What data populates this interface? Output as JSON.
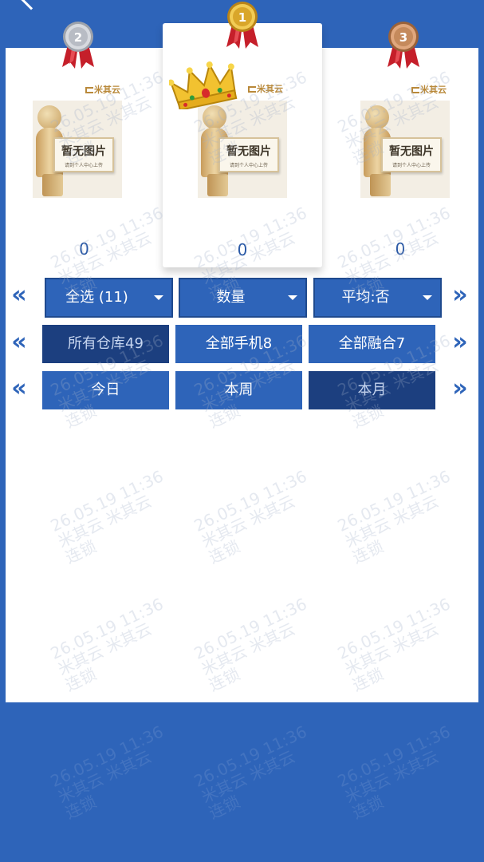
{
  "nav": {
    "back_icon": "chevron-left-icon"
  },
  "podium": {
    "first": {
      "rank": "1",
      "medal_color": "#d9a62a",
      "brand": "米其云",
      "sign_title": "暂无图片",
      "sign_sub": "请到个人中心上传",
      "score": "0"
    },
    "second": {
      "rank": "2",
      "medal_color": "#b8bcc4",
      "brand": "米其云",
      "sign_title": "暂无图片",
      "sign_sub": "请到个人中心上传",
      "score": "0"
    },
    "third": {
      "rank": "3",
      "medal_color": "#c58a5c",
      "brand": "米其云",
      "sign_title": "暂无图片",
      "sign_sub": "请到个人中心上传",
      "score": "0"
    }
  },
  "filters": {
    "row1": {
      "select_all": "全选 (11)",
      "quantity": "数量",
      "average": "平均:否"
    },
    "row2": {
      "warehouse": "所有仓库49",
      "phones": "全部手机8",
      "fusion": "全部融合7",
      "active": "warehouse"
    },
    "row3": {
      "today": "今日",
      "this_week": "本周",
      "this_month": "本月",
      "active": "this_month"
    }
  },
  "arrows": {
    "prev": "«",
    "next": "»"
  },
  "watermark": {
    "line1": "26.05.19 11:36",
    "line2": "米其云 米其云",
    "line3": "连锁"
  },
  "colors": {
    "primary": "#2e64b9",
    "active": "#1c3f7f",
    "score": "#2a59a6"
  }
}
